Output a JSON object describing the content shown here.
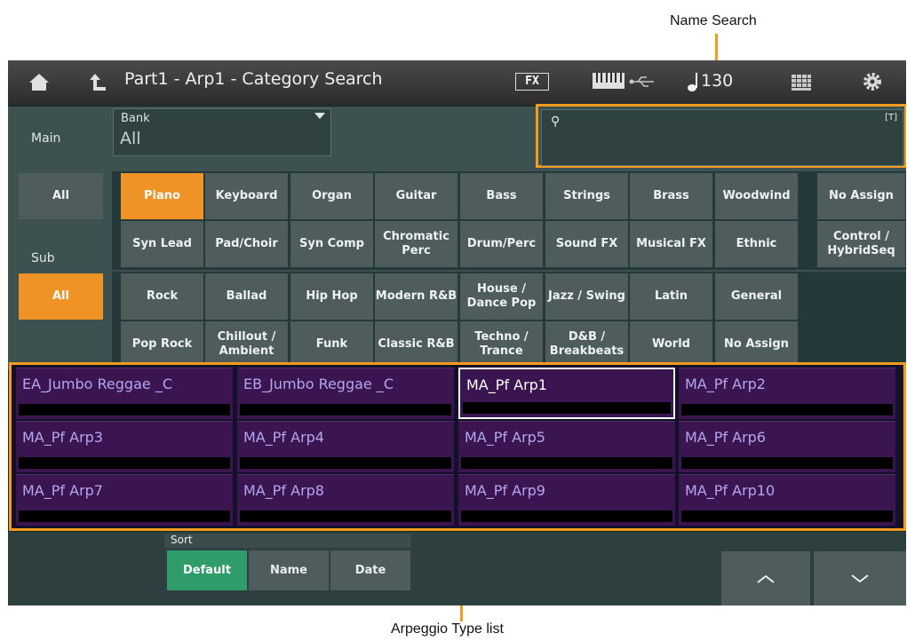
{
  "callouts": {
    "name_search": "Name Search",
    "type_list": "Arpeggio Type list"
  },
  "header": {
    "title": "Part1 - Arp1 - Category Search",
    "fx": "FX",
    "tempo": "130"
  },
  "labels": {
    "main": "Main",
    "sub": "Sub"
  },
  "bank": {
    "caption": "Bank",
    "value": "All"
  },
  "search": {
    "value": "",
    "kb_label": "[T]"
  },
  "main_all": "All",
  "main_categories": [
    "Piano",
    "Keyboard",
    "Organ",
    "Guitar",
    "Bass",
    "Strings",
    "Brass",
    "Woodwind",
    "Syn Lead",
    "Pad/Choir",
    "Syn Comp",
    "Chromatic Perc",
    "Drum/Perc",
    "Sound FX",
    "Musical FX",
    "Ethnic"
  ],
  "main_no_assign": "No Assign",
  "main_control": "Control / HybridSeq",
  "selected_main": "Piano",
  "sub_all": "All",
  "sub_categories": [
    "Rock",
    "Ballad",
    "Hip Hop",
    "Modern R&B",
    "House / Dance Pop",
    "Jazz / Swing",
    "Latin",
    "General",
    "Pop Rock",
    "Chillout / Ambient",
    "Funk",
    "Classic R&B",
    "Techno / Trance",
    "D&B / Breakbeats",
    "World",
    "No Assign"
  ],
  "types": [
    "EA_Jumbo Reggae _C",
    "EB_Jumbo Reggae _C",
    "MA_Pf Arp1",
    "MA_Pf Arp2",
    "MA_Pf Arp3",
    "MA_Pf Arp4",
    "MA_Pf Arp5",
    "MA_Pf Arp6",
    "MA_Pf Arp7",
    "MA_Pf Arp8",
    "MA_Pf Arp9",
    "MA_Pf Arp10"
  ],
  "selected_type": "MA_Pf Arp1",
  "sort": {
    "caption": "Sort",
    "options": [
      "Default",
      "Name",
      "Date"
    ],
    "selected": "Default"
  },
  "colors": {
    "accent": "#f49a1c",
    "selected_category": "#f09326",
    "selected_sort": "#2f9c6a",
    "list_bg": "#3a1550",
    "list_text": "#b5a6f0"
  },
  "icons": {
    "home": "home-icon",
    "back": "back-arrow-icon",
    "keyboard": "keyboard-icon",
    "usb": "usb-icon",
    "note": "quarter-note-icon",
    "grid": "grid-icon",
    "settings": "gear-icon",
    "search": "search-icon",
    "page_up": "chevron-up-icon",
    "page_down": "chevron-down-icon"
  }
}
